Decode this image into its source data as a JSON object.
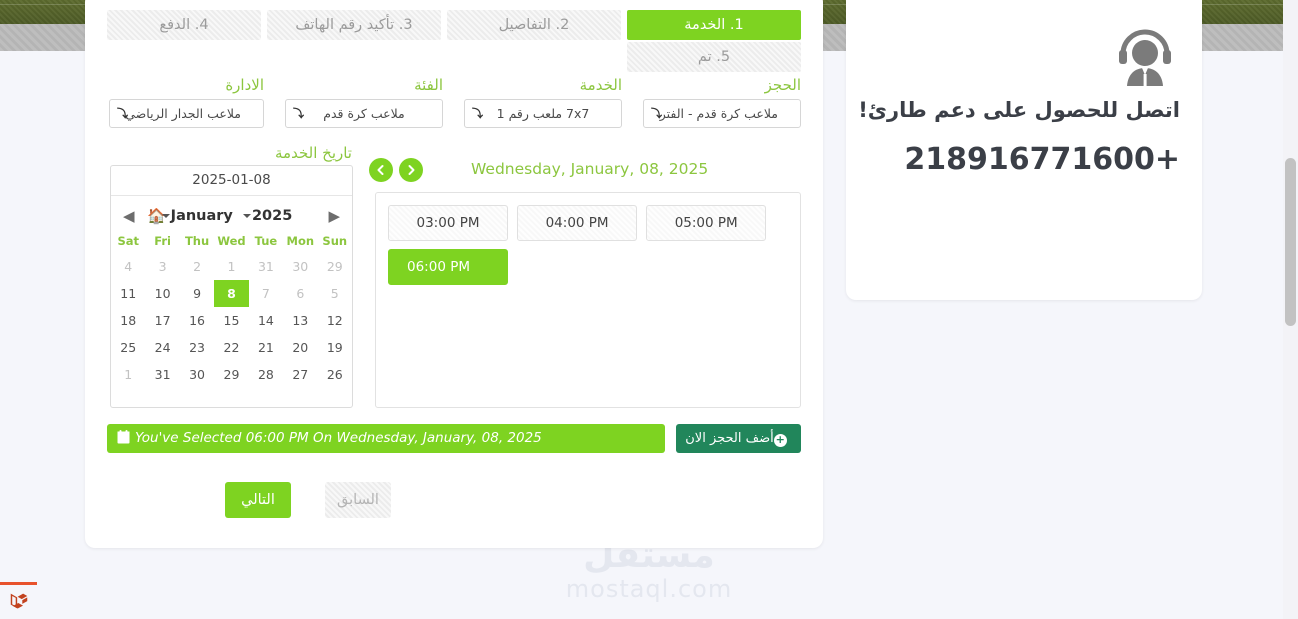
{
  "support": {
    "icon": "headset-agent-icon",
    "title": "اتصل للحصول على دعم طارئ!",
    "phone": "+218916771600"
  },
  "wizard": {
    "tabs": [
      {
        "key": "service",
        "label": "1. الخدمة",
        "active": true
      },
      {
        "key": "details",
        "label": "2. التفاصيل",
        "active": false
      },
      {
        "key": "phone-verify",
        "label": "3. تأكيد رقم الهاتف",
        "active": false
      },
      {
        "key": "payment",
        "label": "4. الدفع",
        "active": false
      },
      {
        "key": "done",
        "label": "5. تم",
        "active": false
      }
    ]
  },
  "filters": [
    {
      "key": "booking",
      "label": "الحجز",
      "value": "ملاعب كرة قدم - الفتر"
    },
    {
      "key": "service",
      "label": "الخدمة",
      "value": "7x7 ملعب رقم 1"
    },
    {
      "key": "category",
      "label": "الفئة",
      "value": "ملاعب كرة قدم"
    },
    {
      "key": "department",
      "label": "الادارة",
      "value": "ملاعب الجدار الرياضي"
    }
  ],
  "day": {
    "heading": "Wednesday, January, 08, 2025",
    "prev_icon": "chevron-left-icon",
    "next_icon": "chevron-right-icon"
  },
  "slots": [
    {
      "time": "03:00 PM",
      "selected": false
    },
    {
      "time": "04:00 PM",
      "selected": false
    },
    {
      "time": "05:00 PM",
      "selected": false
    },
    {
      "time": "06:00 PM",
      "selected": true
    }
  ],
  "calendar": {
    "label": "تاريخ الخدمة",
    "input_value": "2025-01-08",
    "month": "January",
    "year": "2025",
    "prev_icon": "triangle-left-icon",
    "home_icon": "home-icon",
    "next_icon": "triangle-right-icon",
    "weekdays": [
      "Sat",
      "Fri",
      "Thu",
      "Wed",
      "Tue",
      "Mon",
      "Sun"
    ],
    "weeks": [
      [
        {
          "d": "4",
          "off": true
        },
        {
          "d": "3",
          "off": true
        },
        {
          "d": "2",
          "off": true
        },
        {
          "d": "1",
          "off": true
        },
        {
          "d": "31",
          "off": true
        },
        {
          "d": "30",
          "off": true
        },
        {
          "d": "29",
          "off": true
        }
      ],
      [
        {
          "d": "11",
          "off": false
        },
        {
          "d": "10",
          "off": false
        },
        {
          "d": "9",
          "off": false
        },
        {
          "d": "8",
          "off": false,
          "selected": true
        },
        {
          "d": "7",
          "off": true
        },
        {
          "d": "6",
          "off": true
        },
        {
          "d": "5",
          "off": true
        }
      ],
      [
        {
          "d": "18",
          "off": false
        },
        {
          "d": "17",
          "off": false
        },
        {
          "d": "16",
          "off": false
        },
        {
          "d": "15",
          "off": false
        },
        {
          "d": "14",
          "off": false
        },
        {
          "d": "13",
          "off": false
        },
        {
          "d": "12",
          "off": false
        }
      ],
      [
        {
          "d": "25",
          "off": false
        },
        {
          "d": "24",
          "off": false
        },
        {
          "d": "23",
          "off": false
        },
        {
          "d": "22",
          "off": false
        },
        {
          "d": "21",
          "off": false
        },
        {
          "d": "20",
          "off": false
        },
        {
          "d": "19",
          "off": false
        }
      ],
      [
        {
          "d": "1",
          "off": true
        },
        {
          "d": "31",
          "off": false
        },
        {
          "d": "30",
          "off": false
        },
        {
          "d": "29",
          "off": false
        },
        {
          "d": "28",
          "off": false
        },
        {
          "d": "27",
          "off": false
        },
        {
          "d": "26",
          "off": false
        }
      ]
    ]
  },
  "actions": {
    "add_booking": "أضف الحجز الان",
    "add_icon": "plus-circle-icon",
    "selection_icon": "calendar-icon",
    "selection_text": "You've Selected 06:00 PM On Wednesday, January, 08, 2025",
    "next": "التالي",
    "prev": "السابق"
  },
  "watermark": {
    "arabic": "مستقل",
    "latin": "mostaql.com"
  },
  "debugbar": {
    "icon": "laravel-icon"
  },
  "colors": {
    "accent_green": "#7ED321",
    "label_green": "#8CC63F",
    "dark_green": "#21865b",
    "muted": "#9b9b9b",
    "hero": "#4e5c27"
  }
}
